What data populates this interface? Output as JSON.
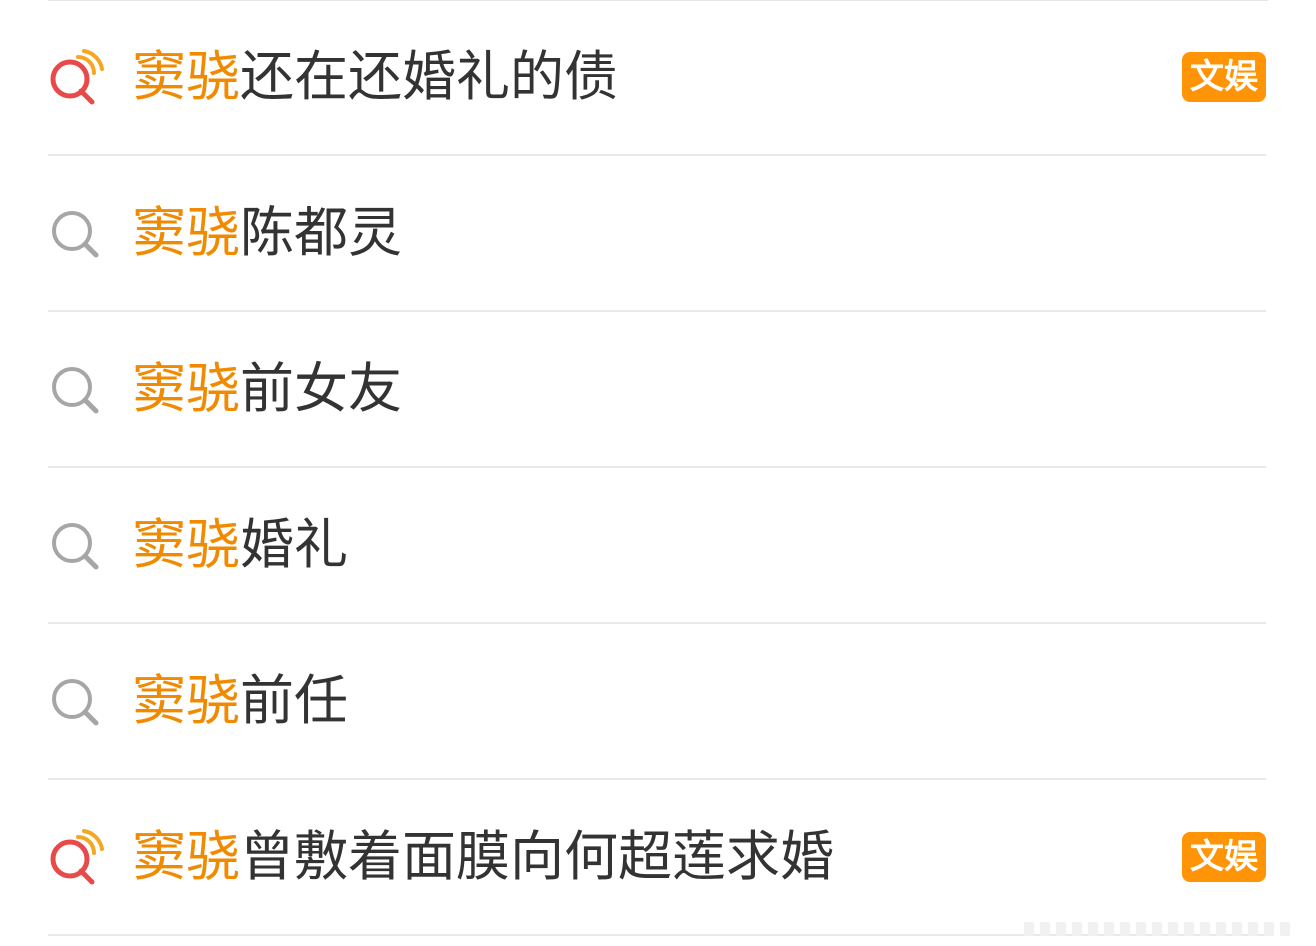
{
  "colors": {
    "highlight": "#f08a00",
    "text": "#333333",
    "badge_bg": "#ff9406",
    "divider": "#e9e9e9"
  },
  "results": [
    {
      "prefix": "窦骁",
      "suffix": "还在还婚礼的债",
      "icon": "hot-search-icon",
      "badge": "文娱"
    },
    {
      "prefix": "窦骁",
      "suffix": "陈都灵",
      "icon": "search-icon"
    },
    {
      "prefix": "窦骁",
      "suffix": "前女友",
      "icon": "search-icon"
    },
    {
      "prefix": "窦骁",
      "suffix": "婚礼",
      "icon": "search-icon"
    },
    {
      "prefix": "窦骁",
      "suffix": "前任",
      "icon": "search-icon"
    },
    {
      "prefix": "窦骁",
      "suffix": "曾敷着面膜向何超莲求婚",
      "icon": "hot-search-icon",
      "badge": "文娱"
    }
  ]
}
